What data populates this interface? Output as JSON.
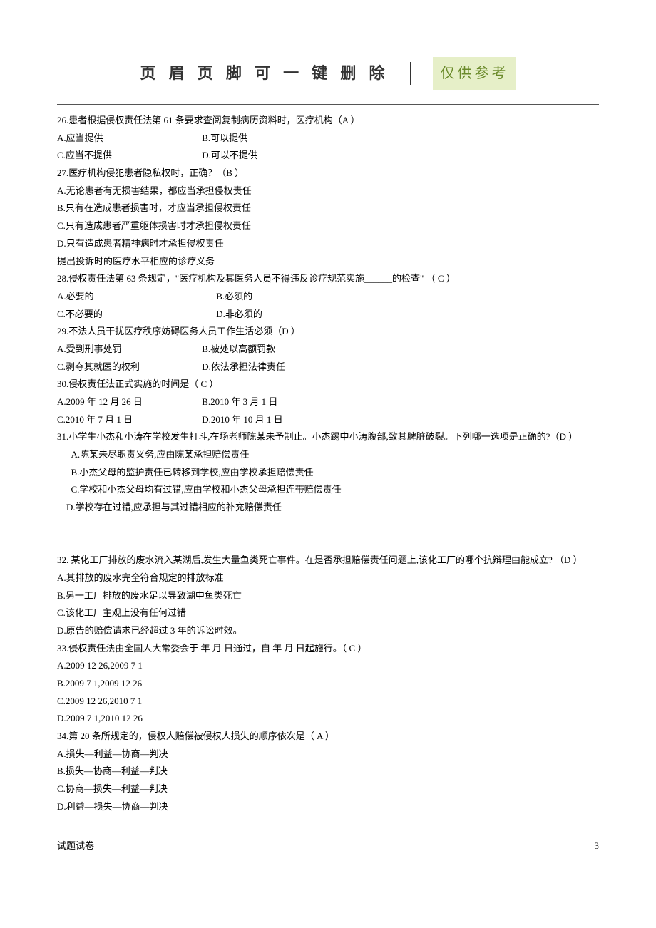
{
  "header": {
    "title": "页 眉 页 脚 可 一 键 删 除",
    "badge": "仅供参考"
  },
  "q26": {
    "stem": "26.患者根据侵权责任法第 61 条要求查阅复制病历资料时，医疗机构（A ）",
    "a": "A.应当提供",
    "b": "B.可以提供",
    "c": "C.应当不提供",
    "d": "D.可以不提供"
  },
  "q27": {
    "stem": "27.医疗机构侵犯患者隐私权时，正确？（B ）",
    "a": "A.无论患者有无损害结果，都应当承担侵权责任",
    "b": "B.只有在造成患者损害时，才应当承担侵权责任",
    "c": "C.只有造成患者严重躯体损害时才承担侵权责任",
    "d": "D.只有造成患者精神病时才承担侵权责任",
    "extra": "提出投诉时的医疗水平相应的诊疗义务"
  },
  "q28": {
    "stem": "28.侵权责任法第 63 条规定，\"医疗机构及其医务人员不得违反诊疗规范实施______的检查\" （ C ）",
    "a": "A.必要的",
    "b": "B.必须的",
    "c": "C.不必要的",
    "d": "D.非必须的"
  },
  "q29": {
    "stem": "29.不法人员干扰医疗秩序妨碍医务人员工作生活必须（D  ）",
    "a": "A.受到刑事处罚",
    "b": "B.被处以高额罚款",
    "c": "C.剥夺其就医的权利",
    "d": "D.依法承担法律责任"
  },
  "q30": {
    "stem": "30.侵权责任法正式实施的时间是（ C ）",
    "a": "A.2009 年 12 月 26 日",
    "b": "B.2010 年 3 月 1 日",
    "c": "C.2010 年 7 月 1 日",
    "d": "D.2010 年 10 月 1 日"
  },
  "q31": {
    "stem": "31.小学生小杰和小涛在学校发生打斗,在场老师陈某未予制止。小杰踢中小涛腹部,致其脾脏破裂。下列哪一选项是正确的?（D ）",
    "a": "A.陈某未尽职责义务,应由陈某承担赔偿责任",
    "b": "B.小杰父母的监护责任已转移到学校,应由学校承担赔偿责任",
    "c": "C.学校和小杰父母均有过错,应由学校和小杰父母承担连带赔偿责任",
    "d": "D.学校存在过错,应承担与其过错相应的补充赔偿责任"
  },
  "q32": {
    "stem": "32. 某化工厂排放的废水流入某湖后,发生大量鱼类死亡事件。在是否承担赔偿责任问题上,该化工厂的哪个抗辩理由能成立? （D ）",
    "a": "A.其排放的废水完全符合规定的排放标准",
    "b": "B.另一工厂排放的废水足以导致湖中鱼类死亡",
    "c": "C.该化工厂主观上没有任何过错",
    "d": "D.原告的赔偿请求已经超过 3 年的诉讼时效。"
  },
  "q33": {
    "stem": "33.侵权责任法由全国人大常委会于  年  月  日通过，自   年  月  日起施行。（ C ）",
    "a": "A.2009 12 26,2009 7 1",
    "b": "B.2009 7 1,2009 12 26",
    "c": "C.2009 12 26,2010 7 1",
    "d": "D.2009 7 1,2010 12 26"
  },
  "q34": {
    "stem": "34.第 20 条所规定的，侵权人赔偿被侵权人损失的顺序依次是（  A ）",
    "a": "A.损失—利益—协商—判决",
    "b": "B.损失—协商—利益—判决",
    "c": "C.协商—损失—利益—判决",
    "d": "D.利益—损失—协商—判决"
  },
  "footer": {
    "left": "试题试卷",
    "right": "3"
  }
}
